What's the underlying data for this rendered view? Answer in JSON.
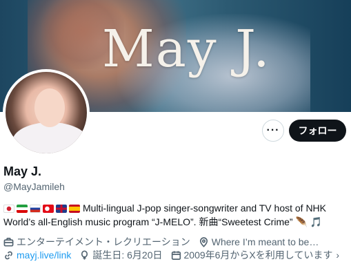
{
  "banner": {
    "logo_text": "May J."
  },
  "profile": {
    "display_name": "May J.",
    "handle": "@MayJamileh",
    "bio_text": "Multi-lingual J-pop singer-songwriter and TV host of NHK World’s all-English music program “J-MELO”. 新曲“Sweetest Crime”",
    "bio_flags": [
      "japan-flag",
      "iran-flag",
      "russia-flag",
      "turkey-flag",
      "uk-flag",
      "spain-flag"
    ],
    "bio_trailing_emoji": [
      "🪶",
      "🎵"
    ],
    "category": "エンターテイメント・レクリエーション",
    "location": "Where I’m meant to be…",
    "website": "mayj.live/link",
    "birthday": "誕生日: 6月20日",
    "joined": "2009年6月からXを利用しています",
    "chevron": "›"
  },
  "actions": {
    "more_label": "···",
    "follow_label": "フォロー"
  },
  "colors": {
    "accent": "#1d9bf0",
    "follow_bg": "#0f1419",
    "muted_text": "#536471"
  }
}
